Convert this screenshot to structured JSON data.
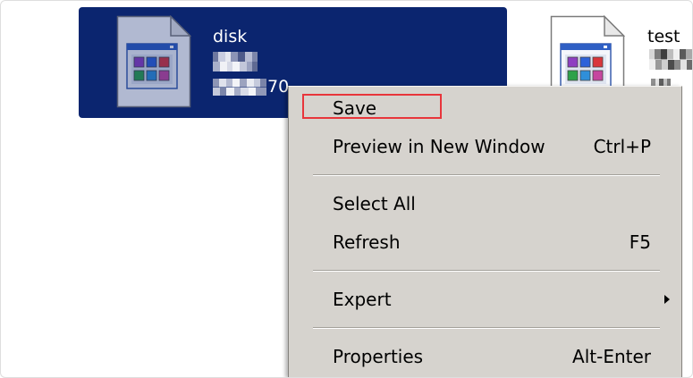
{
  "files": [
    {
      "name": "disk",
      "size_fragment": "70",
      "icon": "document-icon",
      "selected": true
    },
    {
      "name": "test",
      "icon": "document-icon",
      "selected": false
    }
  ],
  "context_menu": {
    "items": [
      {
        "label": "Save",
        "highlighted": true
      },
      {
        "label": "Preview in New Window",
        "shortcut": "Ctrl+P"
      },
      {
        "type": "separator"
      },
      {
        "label": "Select All"
      },
      {
        "label": "Refresh",
        "shortcut": "F5"
      },
      {
        "type": "separator"
      },
      {
        "label": "Expert",
        "submenu": true,
        "icon": "submenu-arrow-icon"
      },
      {
        "type": "separator"
      },
      {
        "label": "Properties",
        "shortcut": "Alt-Enter"
      }
    ]
  },
  "colors": {
    "selection": "#0b256f",
    "menu_background": "#d6d3ce",
    "highlight_box": "#e8353b",
    "selected_text": "#ffffff"
  }
}
